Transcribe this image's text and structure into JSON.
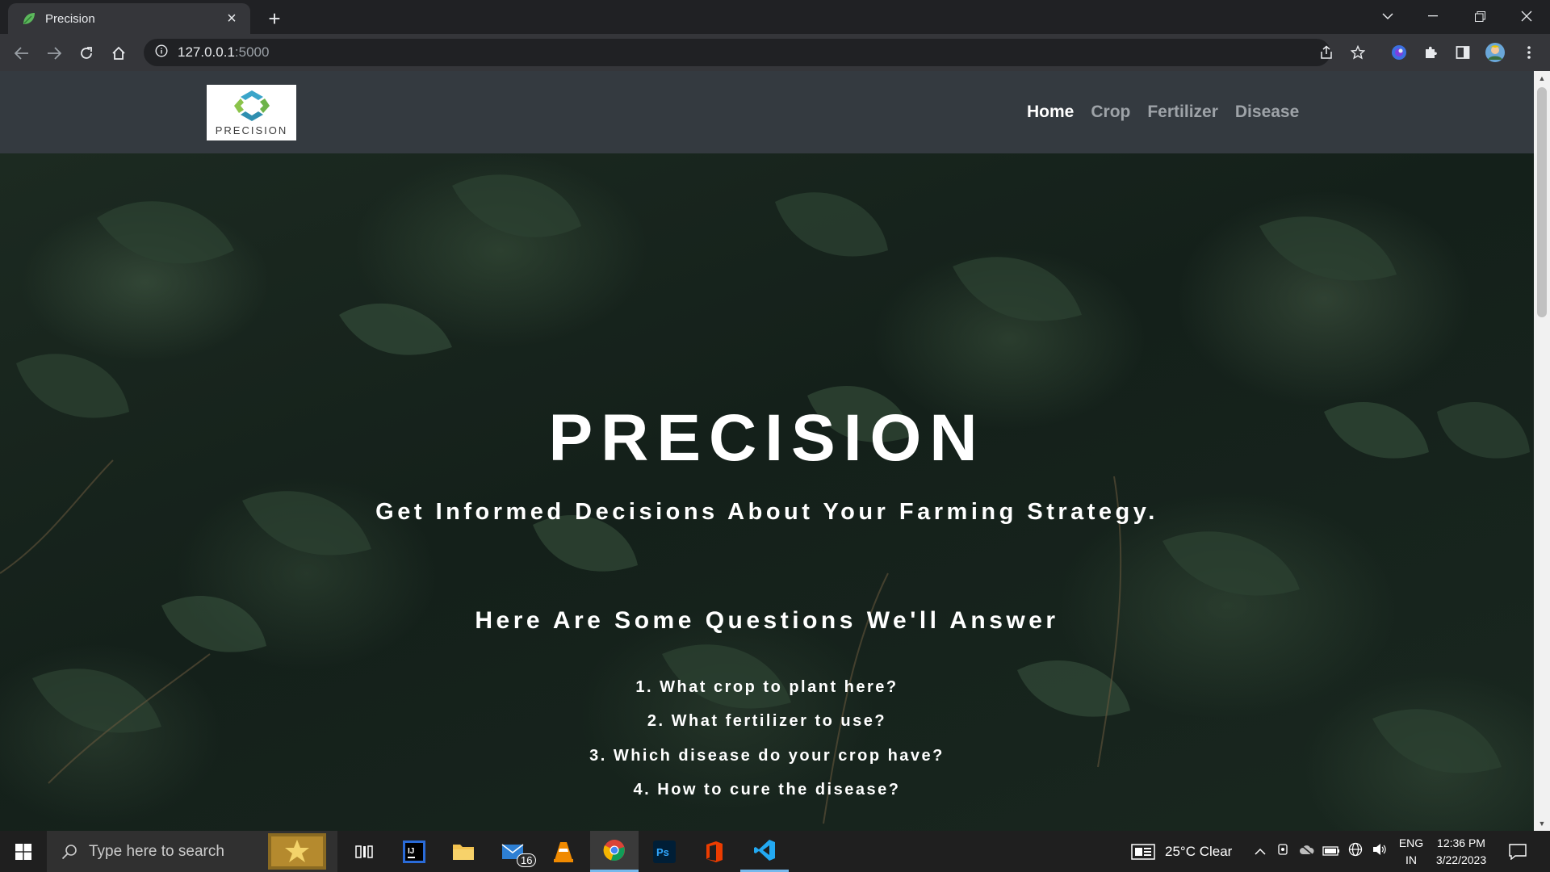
{
  "browser": {
    "tab_title": "Precision",
    "url_host": "127.0.0.1",
    "url_port": ":5000"
  },
  "site": {
    "logo_text": "PRECISION",
    "nav": {
      "home": "Home",
      "crop": "Crop",
      "fertilizer": "Fertilizer",
      "disease": "Disease"
    },
    "hero": {
      "title": "PRECISION",
      "subtitle": "Get Informed Decisions About Your Farming Strategy.",
      "questions_heading": "Here Are Some Questions We'll Answer",
      "questions": [
        "1. What crop to plant here?",
        "2. What fertilizer to use?",
        "3. Which disease do your crop have?",
        "4. How to cure the disease?"
      ]
    }
  },
  "taskbar": {
    "search_placeholder": "Type here to search",
    "mail_badge": "16",
    "weather": "25°C  Clear",
    "lang_line1": "ENG",
    "lang_line2": "IN",
    "time": "12:36 PM",
    "date": "3/22/2023"
  },
  "colors": {
    "nav_bg": "#343a40",
    "nav_active": "#ffffff",
    "nav_inactive": "#9ea3a8",
    "hero_text": "#ffffff"
  }
}
